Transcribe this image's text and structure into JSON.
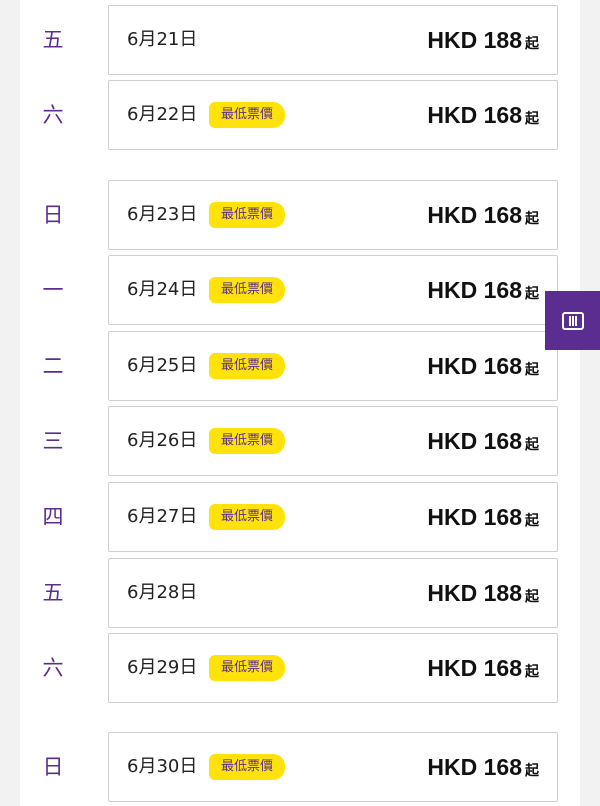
{
  "currency": "HKD",
  "from_suffix": "起",
  "badge_label": "最低票價",
  "colors": {
    "accent_purple": "#5b2d90",
    "badge_yellow": "#ffe20a"
  },
  "side_tab": {
    "icon": "columns-icon"
  },
  "days": [
    {
      "weekday": "五",
      "date": "6月21日",
      "price": "HKD 188",
      "lowest": false
    },
    {
      "weekday": "六",
      "date": "6月22日",
      "price": "HKD 168",
      "lowest": true
    },
    {
      "weekday": "日",
      "date": "6月23日",
      "price": "HKD 168",
      "lowest": true
    },
    {
      "weekday": "一",
      "date": "6月24日",
      "price": "HKD 168",
      "lowest": true
    },
    {
      "weekday": "二",
      "date": "6月25日",
      "price": "HKD 168",
      "lowest": true
    },
    {
      "weekday": "三",
      "date": "6月26日",
      "price": "HKD 168",
      "lowest": true
    },
    {
      "weekday": "四",
      "date": "6月27日",
      "price": "HKD 168",
      "lowest": true
    },
    {
      "weekday": "五",
      "date": "6月28日",
      "price": "HKD 188",
      "lowest": false
    },
    {
      "weekday": "六",
      "date": "6月29日",
      "price": "HKD 168",
      "lowest": true
    },
    {
      "weekday": "日",
      "date": "6月30日",
      "price": "HKD 168",
      "lowest": true
    }
  ]
}
